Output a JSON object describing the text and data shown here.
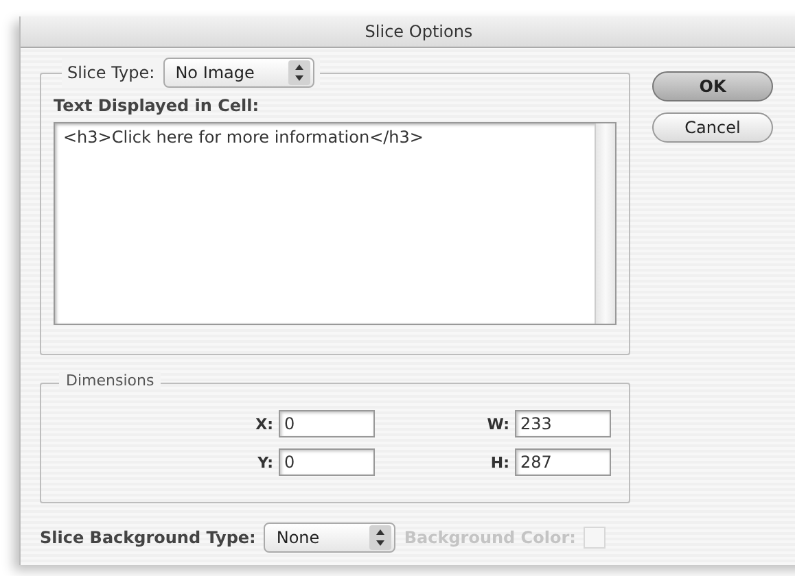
{
  "window": {
    "title": "Slice Options"
  },
  "slice_type": {
    "label": "Slice Type:",
    "value": "No Image"
  },
  "text_cell": {
    "label": "Text Displayed in Cell:",
    "value": "<h3>Click here for more information</h3>"
  },
  "dimensions": {
    "title": "Dimensions",
    "fields": [
      {
        "label": "X:",
        "value": "0"
      },
      {
        "label": "W:",
        "value": "233"
      },
      {
        "label": "Y:",
        "value": "0"
      },
      {
        "label": "H:",
        "value": "287"
      }
    ]
  },
  "background_type": {
    "label": "Slice Background Type:",
    "value": "None"
  },
  "background_color": {
    "label": "Background Color:",
    "disabled": true
  },
  "buttons": [
    {
      "label": "OK",
      "default": true
    },
    {
      "label": "Cancel",
      "default": false
    }
  ]
}
